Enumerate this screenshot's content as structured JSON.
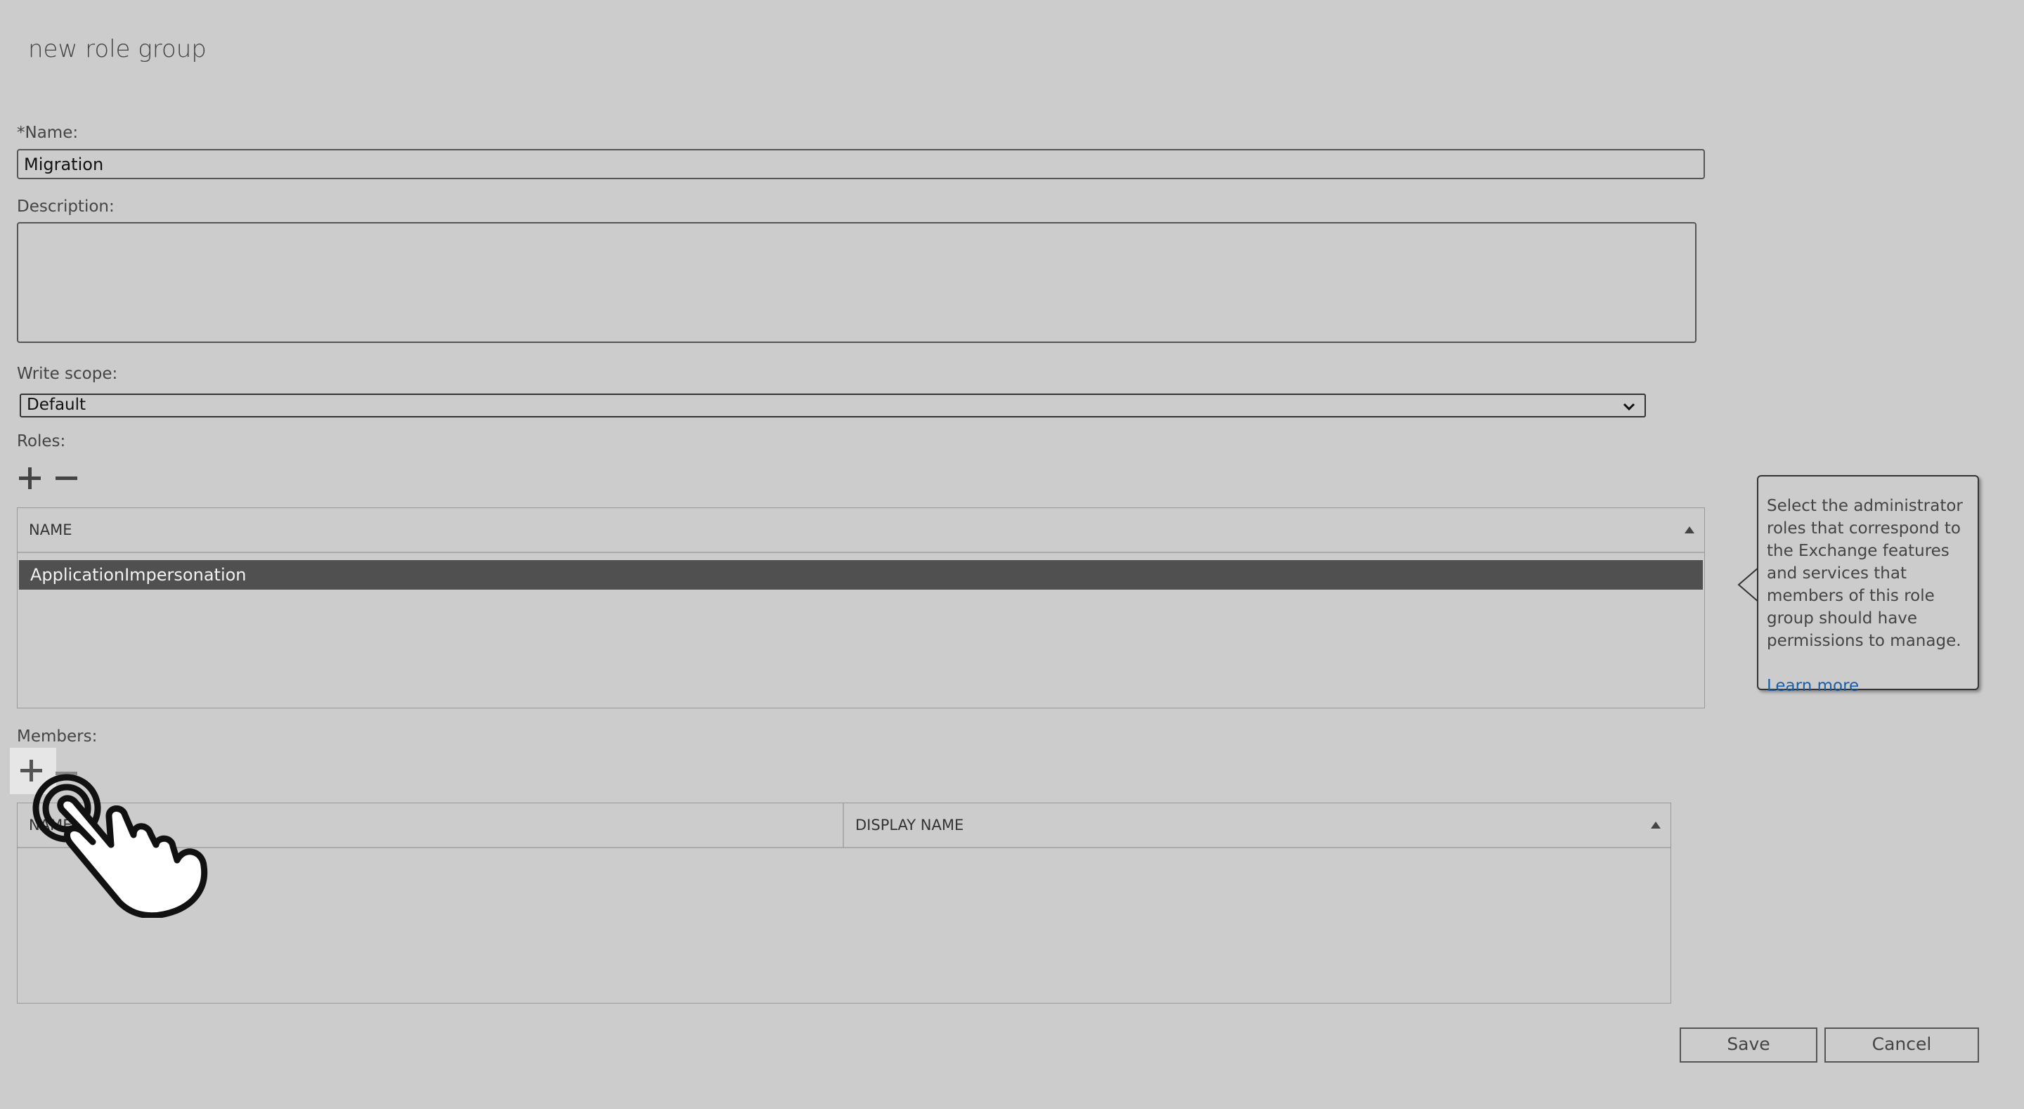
{
  "dialog": {
    "title": "new role group"
  },
  "form": {
    "name_label": "*Name:",
    "name_value": "Migration",
    "description_label": "Description:",
    "description_value": "",
    "write_scope_label": "Write scope:",
    "write_scope_value": "Default",
    "roles_label": "Roles:",
    "members_label": "Members:"
  },
  "roles_table": {
    "headers": [
      "NAME"
    ],
    "rows": [
      "ApplicationImpersonation"
    ]
  },
  "members_table": {
    "headers": [
      "NAME",
      "DISPLAY NAME"
    ],
    "rows": []
  },
  "callout": {
    "text": "Select the administrator roles that correspond to the Exchange features and services that members of this role group should have permissions to manage.",
    "link": "Learn more"
  },
  "buttons": {
    "save": "Save",
    "cancel": "Cancel"
  },
  "icons": {
    "add": "plus-icon",
    "remove": "minus-icon",
    "pointer": "hand-pointer-icon"
  },
  "colors": {
    "background": "#cccccc",
    "selected_row": "#505050",
    "link": "#1a5fa8"
  }
}
